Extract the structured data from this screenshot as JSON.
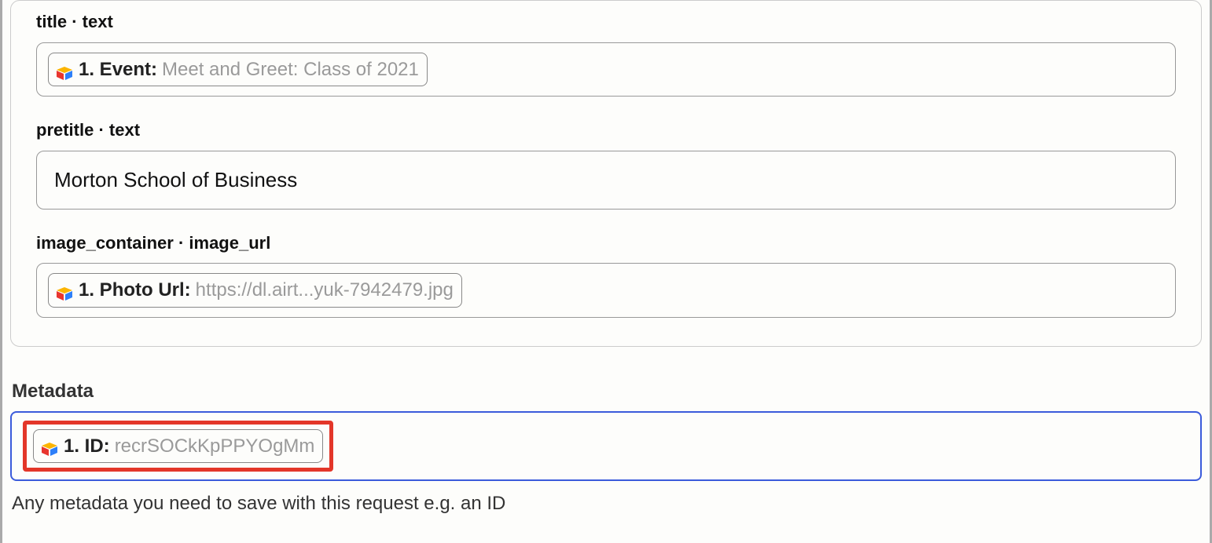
{
  "panel": {
    "fields": {
      "title": {
        "label": "title · text",
        "token_prefix": "1. Event:",
        "token_value": "Meet and Greet: Class of 2021"
      },
      "pretitle": {
        "label": "pretitle · text",
        "value": "Morton School of Business"
      },
      "image_container": {
        "label": "image_container · image_url",
        "token_prefix": "1. Photo Url:",
        "token_value": "https://dl.airt...yuk-7942479.jpg"
      }
    }
  },
  "metadata": {
    "heading": "Metadata",
    "token_prefix": "1. ID:",
    "token_value": "recrSOCkKpPPYOgMm",
    "help": "Any metadata you need to save with this request e.g. an ID"
  }
}
